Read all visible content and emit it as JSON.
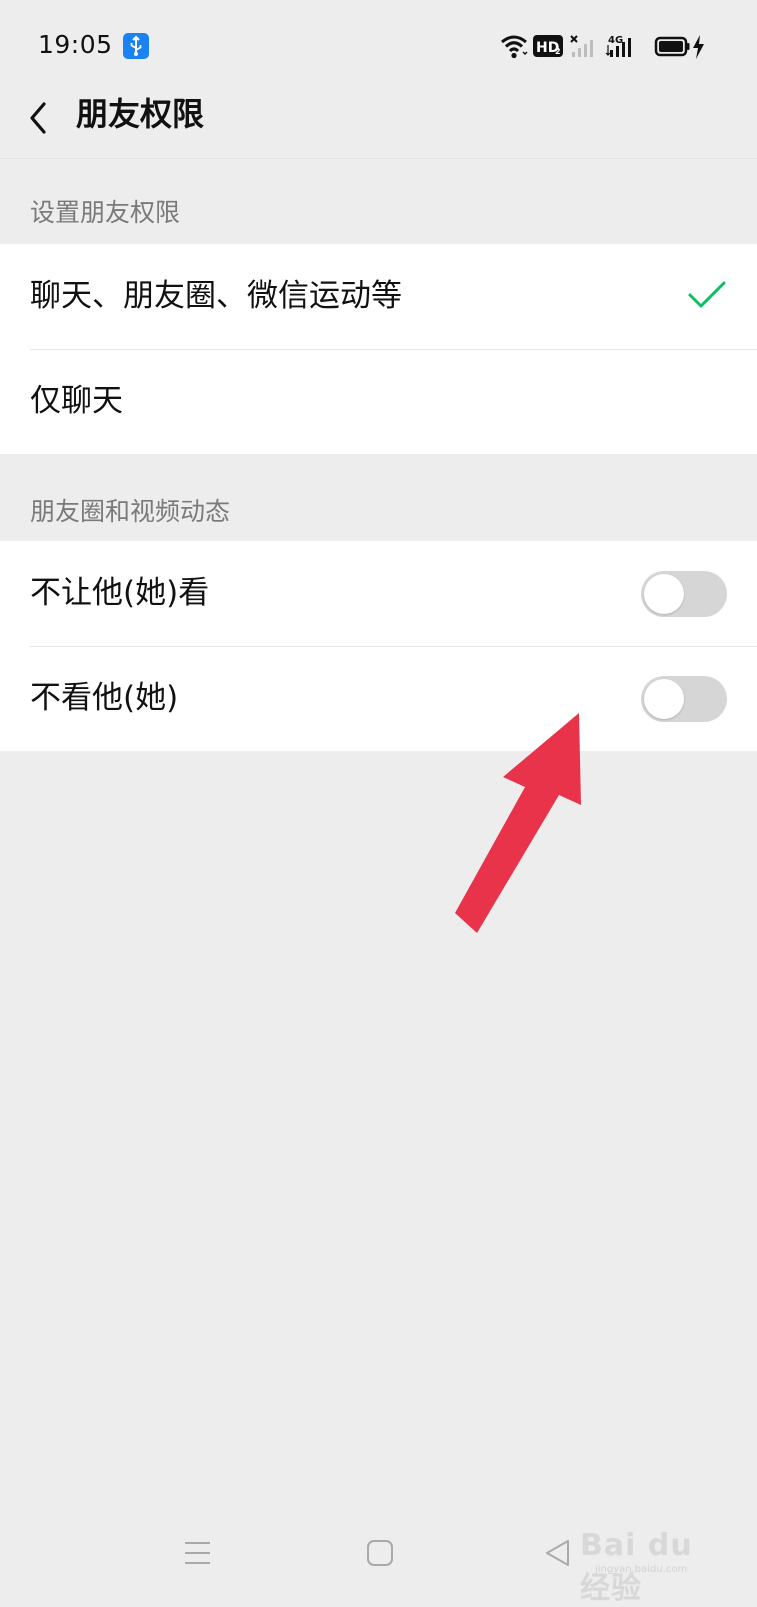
{
  "status_bar": {
    "time": "19:05",
    "left_icons": [
      "usb-debug-icon"
    ],
    "right_icons": [
      "wifi-icon",
      "hd-voice-icon",
      "no-signal-sim1-icon",
      "4g-signal-icon",
      "battery-charging-icon"
    ],
    "hd_label": "HD",
    "hd_sub": "2",
    "network_label": "4G"
  },
  "nav": {
    "back_icon": "chevron-left-icon",
    "title": "朋友权限"
  },
  "sections": [
    {
      "header": "设置朋友权限",
      "items": [
        {
          "label": "聊天、朋友圈、微信运动等",
          "selected": true,
          "icon": "checkmark-icon"
        },
        {
          "label": "仅聊天",
          "selected": false
        }
      ]
    },
    {
      "header": "朋友圈和视频动态",
      "items": [
        {
          "label": "不让他(她)看",
          "toggle_on": false
        },
        {
          "label": "不看他(她)",
          "toggle_on": false
        }
      ]
    }
  ],
  "annotation": {
    "icon": "arrow-icon",
    "color": "#e8334a"
  },
  "system_nav": {
    "icons": [
      "menu-icon",
      "home-icon",
      "back-triangle-icon"
    ]
  },
  "watermark": {
    "text": "Bai du 经验",
    "sub": "jingyan.baidu.com"
  },
  "colors": {
    "accent_green": "#07c160",
    "background": "#ededed",
    "toggle_off": "#d6d6d6",
    "usb_badge": "#1a82f3"
  }
}
